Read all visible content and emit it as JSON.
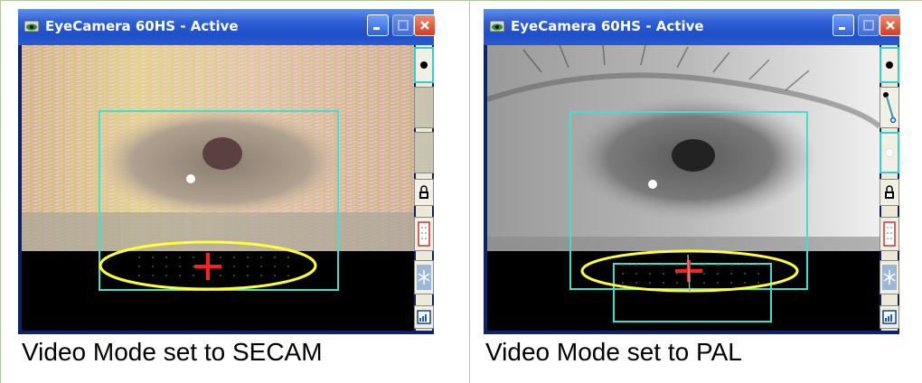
{
  "panels": [
    {
      "window_title": "EyeCamera 60HS - Active",
      "caption": "Video Mode set to SECAM",
      "mode": "SECAM"
    },
    {
      "window_title": "EyeCamera 60HS - Active",
      "caption": "Video Mode set to PAL",
      "mode": "PAL"
    }
  ],
  "icons": {
    "window": "eye-camera-icon",
    "minimize": "minimize-icon",
    "maximize": "maximize-icon",
    "close": "close-icon",
    "sidebar": [
      "pupil-icon",
      "threshold-icon",
      "cr-icon",
      "lock-icon",
      "grid-icon",
      "freeze-icon",
      "chart-icon"
    ]
  },
  "colors": {
    "titlebar": "#2f5fd6",
    "roi_box": "#40e0d0",
    "pupil_ellipse": "#ffff33",
    "crosshair": "#ff2020",
    "panel_border": "#b3c79a"
  }
}
